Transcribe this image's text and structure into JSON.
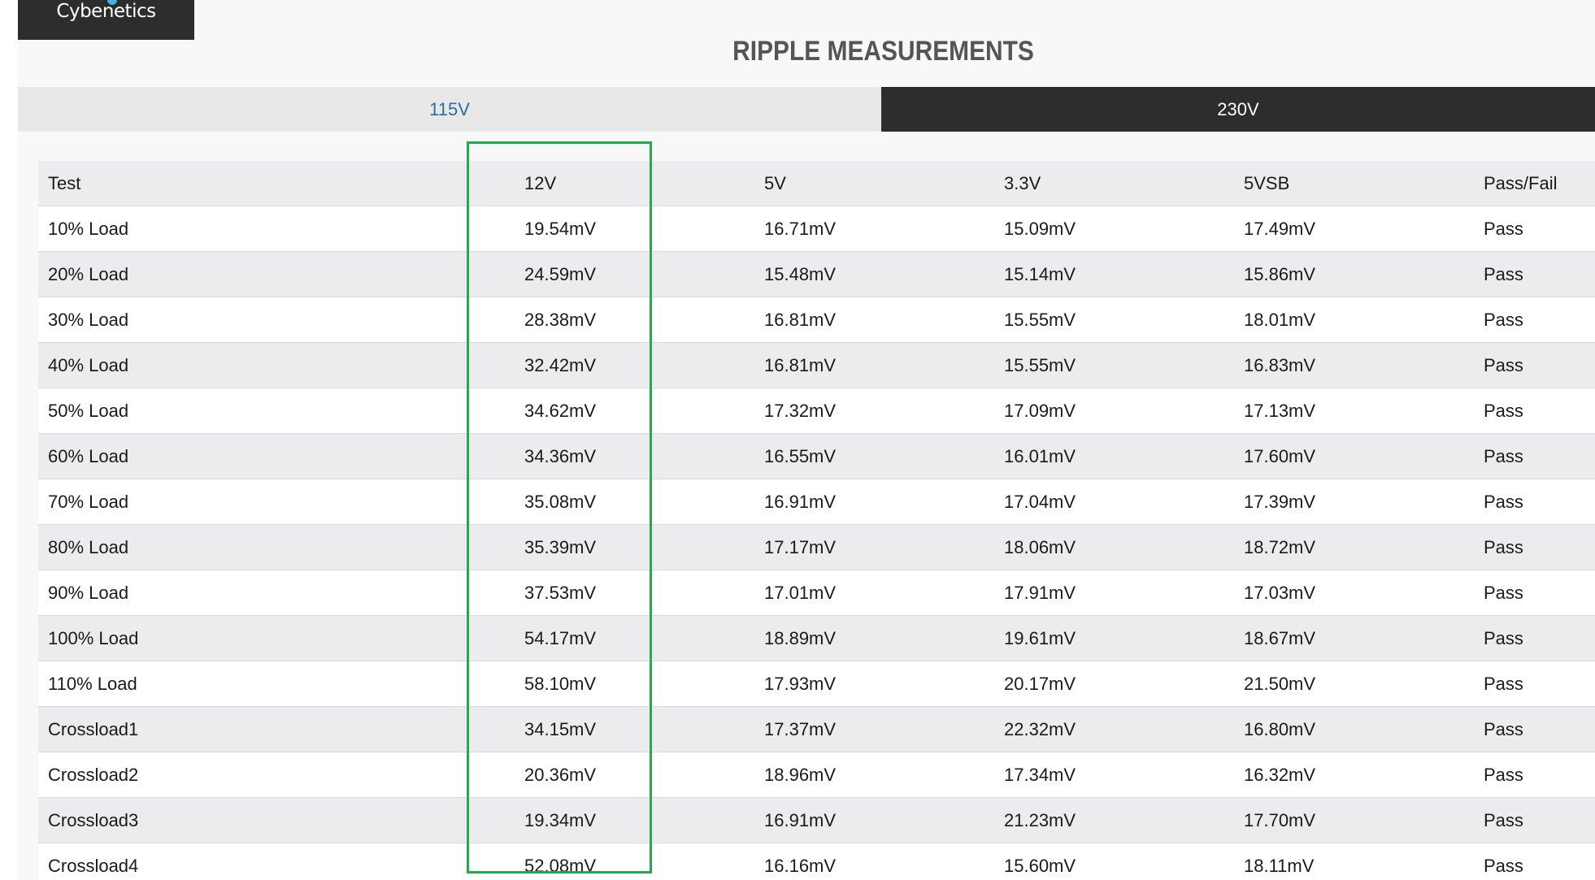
{
  "brand": {
    "logo_text": "Cybenetics"
  },
  "page_title": "RIPPLE MEASUREMENTS",
  "tabs": [
    {
      "label": "115V",
      "active": true
    },
    {
      "label": "230V",
      "active": false
    }
  ],
  "colors": {
    "highlight_box": "#21ad4b",
    "active_tab_text": "#2a6f9e",
    "dark_tab_bg": "#2d2d2d"
  },
  "table": {
    "headers": [
      "Test",
      "12V",
      "5V",
      "3.3V",
      "5VSB",
      "Pass/Fail"
    ],
    "rows": [
      [
        "10% Load",
        "19.54mV",
        "16.71mV",
        "15.09mV",
        "17.49mV",
        "Pass"
      ],
      [
        "20% Load",
        "24.59mV",
        "15.48mV",
        "15.14mV",
        "15.86mV",
        "Pass"
      ],
      [
        "30% Load",
        "28.38mV",
        "16.81mV",
        "15.55mV",
        "18.01mV",
        "Pass"
      ],
      [
        "40% Load",
        "32.42mV",
        "16.81mV",
        "15.55mV",
        "16.83mV",
        "Pass"
      ],
      [
        "50% Load",
        "34.62mV",
        "17.32mV",
        "17.09mV",
        "17.13mV",
        "Pass"
      ],
      [
        "60% Load",
        "34.36mV",
        "16.55mV",
        "16.01mV",
        "17.60mV",
        "Pass"
      ],
      [
        "70% Load",
        "35.08mV",
        "16.91mV",
        "17.04mV",
        "17.39mV",
        "Pass"
      ],
      [
        "80% Load",
        "35.39mV",
        "17.17mV",
        "18.06mV",
        "18.72mV",
        "Pass"
      ],
      [
        "90% Load",
        "37.53mV",
        "17.01mV",
        "17.91mV",
        "17.03mV",
        "Pass"
      ],
      [
        "100% Load",
        "54.17mV",
        "18.89mV",
        "19.61mV",
        "18.67mV",
        "Pass"
      ],
      [
        "110% Load",
        "58.10mV",
        "17.93mV",
        "20.17mV",
        "21.50mV",
        "Pass"
      ],
      [
        "Crossload1",
        "34.15mV",
        "17.37mV",
        "22.32mV",
        "16.80mV",
        "Pass"
      ],
      [
        "Crossload2",
        "20.36mV",
        "18.96mV",
        "17.34mV",
        "16.32mV",
        "Pass"
      ],
      [
        "Crossload3",
        "19.34mV",
        "16.91mV",
        "21.23mV",
        "17.70mV",
        "Pass"
      ],
      [
        "Crossload4",
        "52.08mV",
        "16.16mV",
        "15.60mV",
        "18.11mV",
        "Pass"
      ]
    ]
  }
}
